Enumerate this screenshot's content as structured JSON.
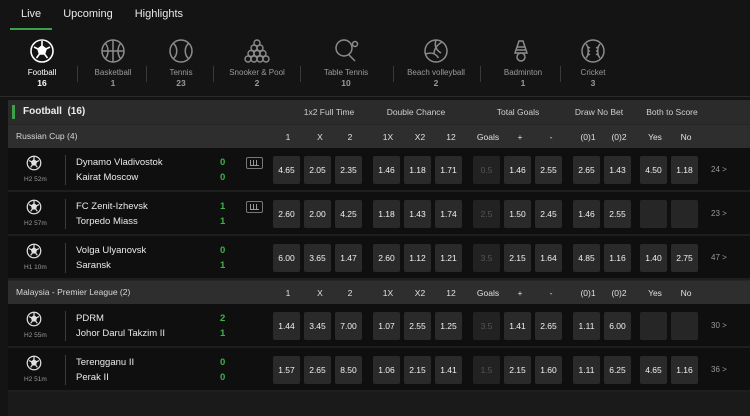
{
  "tabs": [
    "Live",
    "Upcoming",
    "Highlights"
  ],
  "sports": [
    {
      "name": "Football",
      "count": "16",
      "icon": "football-icon"
    },
    {
      "name": "Basketball",
      "count": "1",
      "icon": "basketball-icon"
    },
    {
      "name": "Tennis",
      "count": "23",
      "icon": "tennis-icon"
    },
    {
      "name": "Snooker & Pool",
      "count": "2",
      "icon": "snooker-icon"
    },
    {
      "name": "Table Tennis",
      "count": "10",
      "icon": "table-tennis-icon"
    },
    {
      "name": "Beach volleyball",
      "count": "2",
      "icon": "volleyball-icon"
    },
    {
      "name": "Badminton",
      "count": "1",
      "icon": "badminton-icon"
    },
    {
      "name": "Cricket",
      "count": "3",
      "icon": "cricket-icon"
    }
  ],
  "header": {
    "title": "Football",
    "count": "(16)",
    "categories": [
      "1x2 Full Time",
      "Double Chance",
      "Total Goals",
      "Draw No Bet",
      "Both to Score"
    ]
  },
  "columns": [
    "1",
    "X",
    "2",
    "1X",
    "X2",
    "12",
    "Goals",
    "+",
    "-",
    "(0)1",
    "(0)2",
    "Yes",
    "No"
  ],
  "leagues": [
    {
      "name": "Russian Cup (4)",
      "matches": [
        {
          "home": "Dynamo Vladivostok",
          "away": "Kairat Moscow",
          "hs": "0",
          "as": "0",
          "time": "H2 52m",
          "odds": [
            "4.65",
            "2.05",
            "2.35",
            "1.46",
            "1.18",
            "1.71",
            "0.5",
            "1.46",
            "2.55",
            "2.65",
            "1.43",
            "4.50",
            "1.18"
          ],
          "more": "24 >"
        },
        {
          "home": "FC Zenit-Izhevsk",
          "away": "Torpedo Miass",
          "hs": "1",
          "as": "1",
          "time": "H2 57m",
          "odds": [
            "2.60",
            "2.00",
            "4.25",
            "1.18",
            "1.43",
            "1.74",
            "2.5",
            "1.50",
            "2.45",
            "1.46",
            "2.55",
            "",
            ""
          ],
          "more": "23 >"
        },
        {
          "home": "Volga Ulyanovsk",
          "away": "Saransk",
          "hs": "0",
          "as": "1",
          "time": "H1 10m",
          "odds": [
            "6.00",
            "3.65",
            "1.47",
            "2.60",
            "1.12",
            "1.21",
            "3.5",
            "2.15",
            "1.64",
            "4.85",
            "1.16",
            "1.40",
            "2.75"
          ],
          "more": "47 >"
        }
      ]
    },
    {
      "name": "Malaysia - Premier League (2)",
      "matches": [
        {
          "home": "PDRM",
          "away": "Johor Darul Takzim II",
          "hs": "2",
          "as": "1",
          "time": "H2 55m",
          "odds": [
            "1.44",
            "3.45",
            "7.00",
            "1.07",
            "2.55",
            "1.25",
            "3.5",
            "1.41",
            "2.65",
            "1.11",
            "6.00",
            "",
            ""
          ],
          "more": "30 >"
        },
        {
          "home": "Terengganu II",
          "away": "Perak II",
          "hs": "0",
          "as": "0",
          "time": "H2 51m",
          "odds": [
            "1.57",
            "2.65",
            "8.50",
            "1.06",
            "2.15",
            "1.41",
            "1.5",
            "2.15",
            "1.60",
            "1.11",
            "6.25",
            "4.65",
            "1.16"
          ],
          "more": "36 >"
        }
      ]
    }
  ]
}
